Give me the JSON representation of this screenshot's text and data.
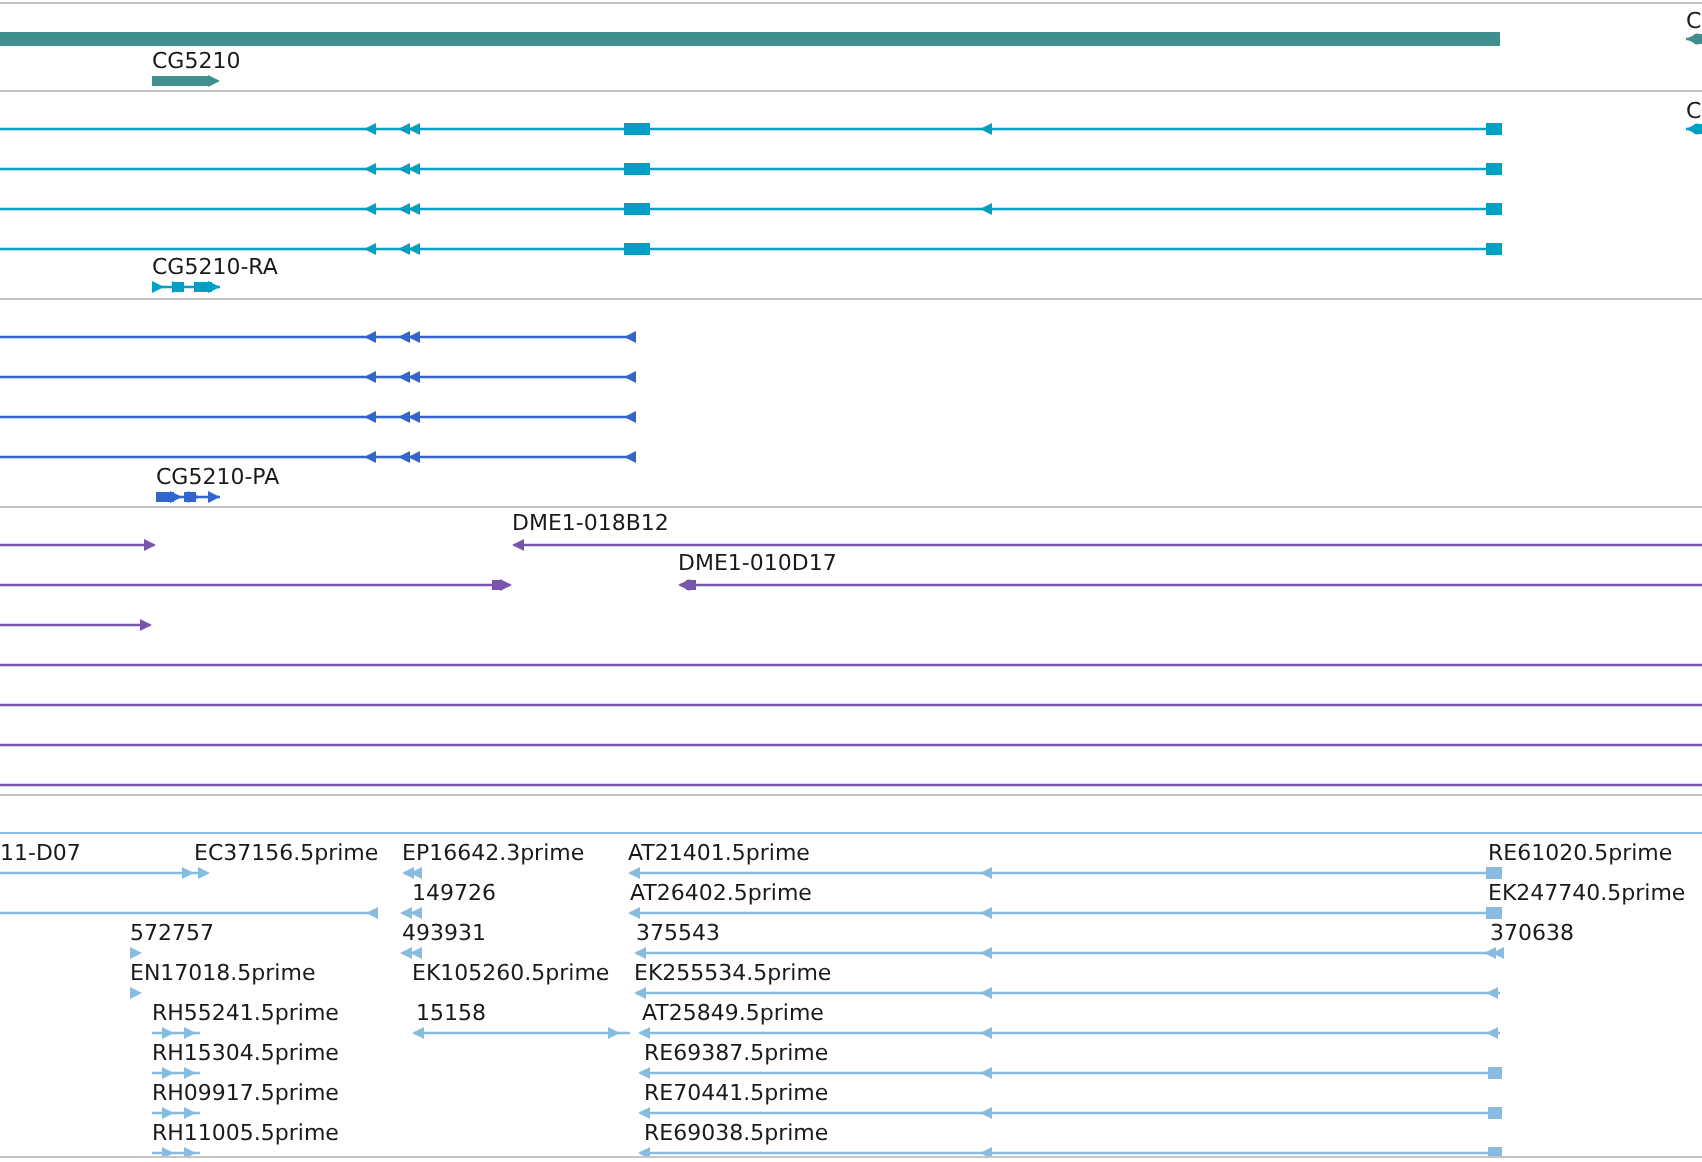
{
  "tracks": [
    {
      "kind": "gene",
      "color": "#3f8f8f",
      "labels": [
        "CG5210",
        "C"
      ]
    },
    {
      "kind": "transcript",
      "color": "#009fc4",
      "labels": [
        "C",
        "CG5210-RA"
      ]
    },
    {
      "kind": "protein",
      "color": "#3366cc",
      "labels": [
        "CG5210-PA"
      ]
    },
    {
      "kind": "clone",
      "color": "#7755aa",
      "labels": [
        "DME1-018B12",
        "DME1-010D17"
      ]
    },
    {
      "kind": "est",
      "color": "#88bbe0",
      "labels": [
        "11-D07",
        "EC37156.5prime",
        "EP16642.3prime",
        "AT21401.5prime",
        "RE61020.5prime",
        "149726",
        "AT26402.5prime",
        "EK247740.5prime",
        "572757",
        "493931",
        "375543",
        "370638",
        "EN17018.5prime",
        "EK105260.5prime",
        "EK255534.5prime",
        "RH55241.5prime",
        "15158",
        "AT25849.5prime",
        "RH15304.5prime",
        "RE69387.5prime",
        "RH09917.5prime",
        "RE70441.5prime",
        "RH11005.5prime",
        "RE69038.5prime"
      ]
    }
  ]
}
